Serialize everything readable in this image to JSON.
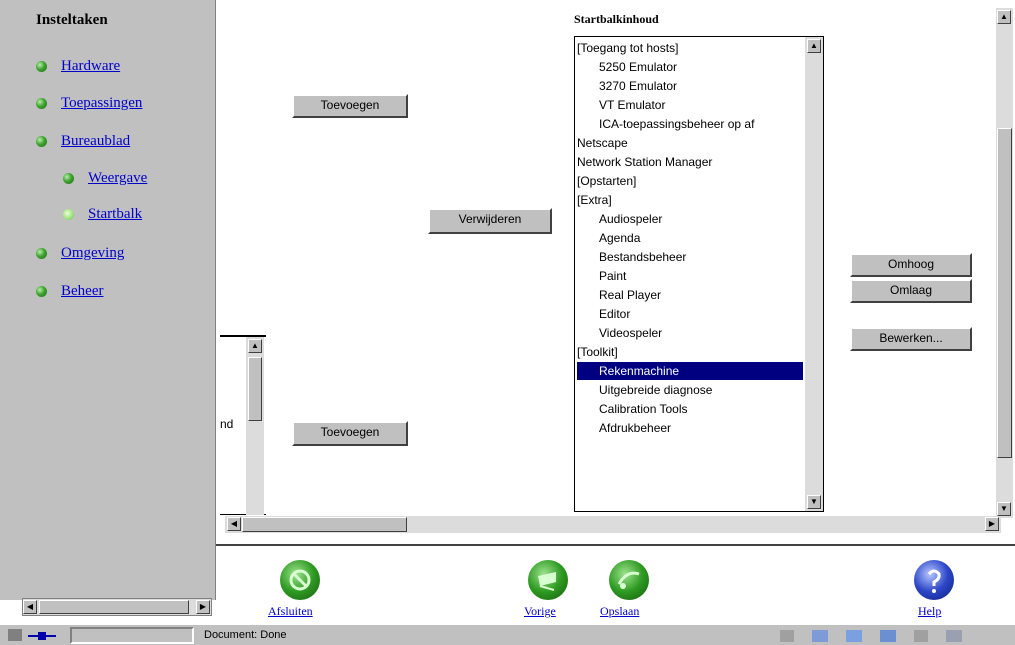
{
  "nav": {
    "title": "Insteltaken",
    "items": [
      {
        "label": "Hardware"
      },
      {
        "label": "Toepassingen"
      },
      {
        "label": "Bureaublad"
      },
      {
        "label": "Weergave"
      },
      {
        "label": "Startbalk"
      },
      {
        "label": "Omgeving"
      },
      {
        "label": "Beheer"
      }
    ]
  },
  "main": {
    "heading": "Startbalkinhoud",
    "add_button_top": "Toevoegen",
    "remove_button": "Verwijderen",
    "add_button_bottom": "Toevoegen",
    "left_list_fragment": "nd",
    "up_button": "Omhoog",
    "down_button": "Omlaag",
    "edit_button": "Bewerken...",
    "list_items": [
      "[Toegang tot hosts]",
      "5250 Emulator",
      "3270 Emulator",
      "VT Emulator",
      "ICA-toepassingsbeheer op af",
      "Netscape",
      "Network Station Manager",
      "[Opstarten]",
      "[Extra]",
      "Audiospeler",
      "Agenda",
      "Bestandsbeheer",
      "Paint",
      "Real Player",
      "Editor",
      "Videospeler",
      "[Toolkit]",
      "Rekenmachine",
      "Uitgebreide diagnose",
      "Calibration Tools",
      "Afdrukbeheer"
    ],
    "selected_item": "Rekenmachine"
  },
  "footer": {
    "exit": "Afsluiten",
    "previous": "Vorige",
    "save": "Opslaan",
    "help": "Help"
  },
  "status": {
    "text": "Document: Done"
  },
  "colors": {
    "selection": "#000080",
    "link": "#0000cc",
    "chrome": "#c0c0c0"
  }
}
